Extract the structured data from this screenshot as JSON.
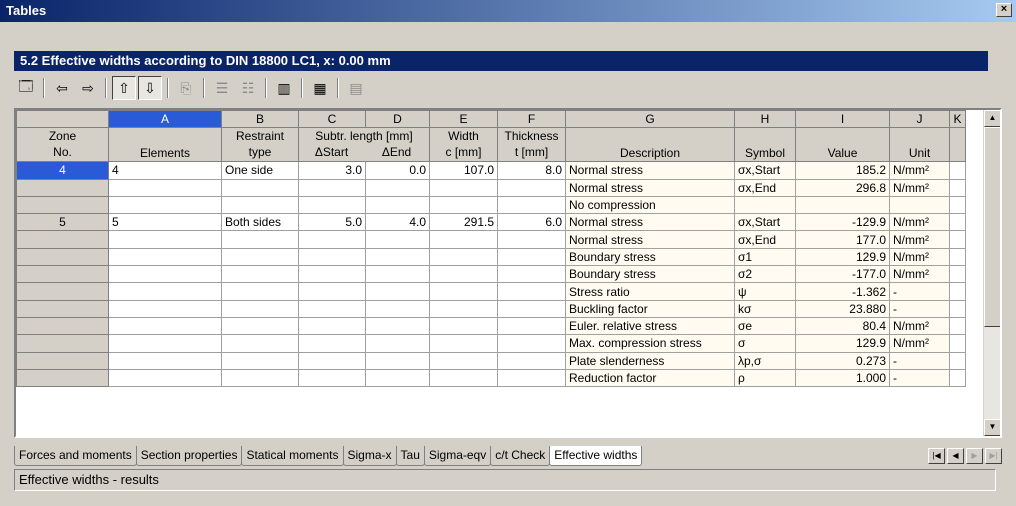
{
  "window": {
    "title": "Tables",
    "close": "×"
  },
  "header": {
    "title": "5.2 Effective widths according to DIN 18800 LC1, x: 0.00 mm"
  },
  "toolbar": {
    "icons": [
      "properties-icon",
      "arrow-left-icon",
      "arrow-right-icon",
      "filter-up-icon",
      "filter-down-icon",
      "copy-icon",
      "insert-row-icon",
      "delete-row-icon",
      "columns-icon",
      "export-icon",
      "calculator-icon"
    ]
  },
  "columns": {
    "letters": [
      "",
      "A",
      "B",
      "C",
      "D",
      "E",
      "F",
      "G",
      "H",
      "I",
      "J",
      "K"
    ],
    "zone": [
      "Zone",
      "No."
    ],
    "elements": "Elements",
    "restraint": [
      "Restraint",
      "type"
    ],
    "subtr_length": "Subtr. length [mm]",
    "delta_start": "ΔStart",
    "delta_end": "ΔEnd",
    "width": [
      "Width",
      "c [mm]"
    ],
    "thickness": [
      "Thickness",
      "t [mm]"
    ],
    "description": "Description",
    "symbol": "Symbol",
    "value": "Value",
    "unit": "Unit"
  },
  "rows": [
    {
      "zone": "4",
      "elements": "4",
      "restraint": "One side",
      "ds": "3.0",
      "de": "0.0",
      "width": "107.0",
      "thick": "8.0",
      "desc": "Normal stress",
      "sym": "σx,Start",
      "value": "185.2",
      "unit": "N/mm²"
    },
    {
      "zone": "",
      "elements": "",
      "restraint": "",
      "ds": "",
      "de": "",
      "width": "",
      "thick": "",
      "desc": "Normal stress",
      "sym": "σx,End",
      "value": "296.8",
      "unit": "N/mm²"
    },
    {
      "zone": "",
      "elements": "",
      "restraint": "",
      "ds": "",
      "de": "",
      "width": "",
      "thick": "",
      "desc": "No compression",
      "sym": "",
      "value": "",
      "unit": ""
    },
    {
      "zone": "5",
      "elements": "5",
      "restraint": "Both sides",
      "ds": "5.0",
      "de": "4.0",
      "width": "291.5",
      "thick": "6.0",
      "desc": "Normal stress",
      "sym": "σx,Start",
      "value": "-129.9",
      "unit": "N/mm²"
    },
    {
      "zone": "",
      "elements": "",
      "restraint": "",
      "ds": "",
      "de": "",
      "width": "",
      "thick": "",
      "desc": "Normal stress",
      "sym": "σx,End",
      "value": "177.0",
      "unit": "N/mm²"
    },
    {
      "zone": "",
      "elements": "",
      "restraint": "",
      "ds": "",
      "de": "",
      "width": "",
      "thick": "",
      "desc": "Boundary stress",
      "sym": "σ1",
      "value": "129.9",
      "unit": "N/mm²"
    },
    {
      "zone": "",
      "elements": "",
      "restraint": "",
      "ds": "",
      "de": "",
      "width": "",
      "thick": "",
      "desc": "Boundary stress",
      "sym": "σ2",
      "value": "-177.0",
      "unit": "N/mm²"
    },
    {
      "zone": "",
      "elements": "",
      "restraint": "",
      "ds": "",
      "de": "",
      "width": "",
      "thick": "",
      "desc": "Stress ratio",
      "sym": "ψ",
      "value": "-1.362",
      "unit": "-"
    },
    {
      "zone": "",
      "elements": "",
      "restraint": "",
      "ds": "",
      "de": "",
      "width": "",
      "thick": "",
      "desc": "Buckling factor",
      "sym": "kσ",
      "value": "23.880",
      "unit": "-"
    },
    {
      "zone": "",
      "elements": "",
      "restraint": "",
      "ds": "",
      "de": "",
      "width": "",
      "thick": "",
      "desc": "Euler. relative stress",
      "sym": "σe",
      "value": "80.4",
      "unit": "N/mm²"
    },
    {
      "zone": "",
      "elements": "",
      "restraint": "",
      "ds": "",
      "de": "",
      "width": "",
      "thick": "",
      "desc": "Max. compression stress",
      "sym": "σ",
      "value": "129.9",
      "unit": "N/mm²"
    },
    {
      "zone": "",
      "elements": "",
      "restraint": "",
      "ds": "",
      "de": "",
      "width": "",
      "thick": "",
      "desc": "Plate slenderness",
      "sym": "λp,σ",
      "value": "0.273",
      "unit": "-"
    },
    {
      "zone": "",
      "elements": "",
      "restraint": "",
      "ds": "",
      "de": "",
      "width": "",
      "thick": "",
      "desc": "Reduction factor",
      "sym": "ρ",
      "value": "1.000",
      "unit": "-"
    }
  ],
  "tabs": [
    "Forces and moments",
    "Section properties",
    "Statical moments",
    "Sigma-x",
    "Tau",
    "Sigma-eqv",
    "c/t Check",
    "Effective widths"
  ],
  "active_tab": "Effective widths",
  "status": "Effective widths - results",
  "colors": {
    "title_blue": "#0a246a",
    "selection": "#2a5bd7",
    "row_cream": "#fffbf0"
  }
}
